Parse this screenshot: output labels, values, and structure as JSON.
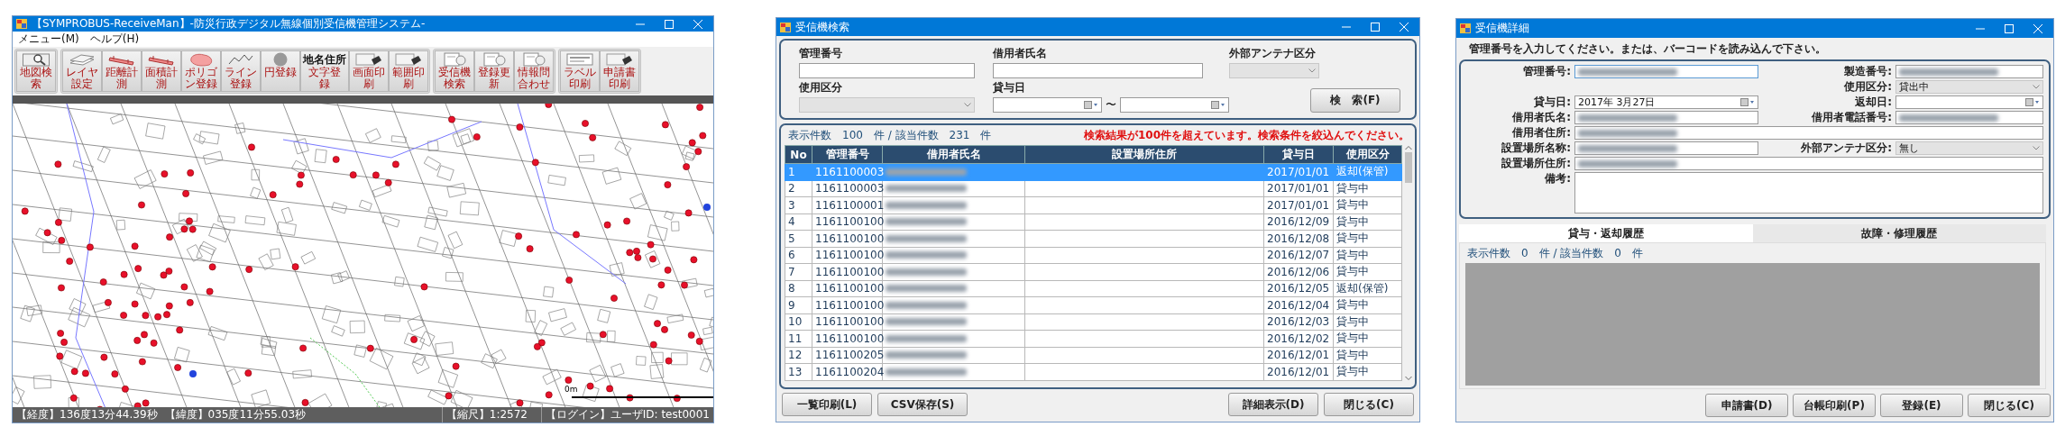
{
  "map_window": {
    "title": "【SYMPROBUS-ReceiveMan】-防災行政デジタル無線個別受信機管理システム-",
    "menu": [
      "メニュー(M)",
      "ヘルプ(H)"
    ],
    "toolbar": [
      [
        {
          "label": "地図検索",
          "kind": "magnifier"
        }
      ],
      [
        {
          "label": "レイヤ設定",
          "kind": "layer"
        },
        {
          "label": "距離計測",
          "kind": "ruler"
        },
        {
          "label": "面積計測",
          "kind": "ruler"
        },
        {
          "label": "ポリゴン登録",
          "kind": "polygon"
        },
        {
          "label": "ライン登録",
          "kind": "line"
        },
        {
          "label": "円登録",
          "kind": "circle"
        },
        {
          "label": "文字登録",
          "kind": "text",
          "icon_text": "地名住所"
        },
        {
          "label": "画面印刷",
          "kind": "printer"
        },
        {
          "label": "範囲印刷",
          "kind": "printer"
        }
      ],
      [
        {
          "label": "受信機検索",
          "kind": "document"
        },
        {
          "label": "登録更新",
          "kind": "document"
        },
        {
          "label": "情報問合わせ",
          "kind": "document"
        }
      ],
      [
        {
          "label": "ラベル印刷",
          "kind": "label"
        },
        {
          "label": "申請書印刷",
          "kind": "printer"
        }
      ]
    ],
    "map": {
      "scale_label": "0m"
    },
    "status_bar": {
      "longitude": "【経度】136度13分44.39秒",
      "latitude": "【緯度】035度11分55.03秒",
      "scale": "【縮尺】1:2572",
      "login": "【ログイン】ユーザID: test0001"
    }
  },
  "search_window": {
    "title": "受信機検索",
    "filter_rows": [
      [
        {
          "label": "管理番号",
          "kind": "text"
        },
        {
          "label": "借用者氏名",
          "kind": "text"
        },
        {
          "label": "外部アンテナ区分",
          "kind": "select",
          "disabled": true
        }
      ],
      [
        {
          "label": "使用区分",
          "kind": "select",
          "disabled": true
        },
        {
          "label": "貸与日",
          "kind": "daterange",
          "separator": "〜"
        }
      ]
    ],
    "search_button": "検　索(F)",
    "count_text": "表示件数　100　件 / 該当件数　231　件",
    "warning": "検索結果が100件を超えています。検索条件を絞込んでください。",
    "table": {
      "columns": [
        "No",
        "管理番号",
        "借用者氏名",
        "設置場所住所",
        "貸与日",
        "使用区分"
      ],
      "rows": [
        {
          "no": "1",
          "id": "1161100003",
          "date": "2017/01/01",
          "status": "返却(保管)",
          "selected": true
        },
        {
          "no": "2",
          "id": "1161100003",
          "date": "2017/01/01",
          "status": "貸与中",
          "selected": false
        },
        {
          "no": "3",
          "id": "1161100001",
          "date": "2017/01/01",
          "status": "貸与中",
          "selected": false
        },
        {
          "no": "4",
          "id": "1161100100",
          "date": "2016/12/09",
          "status": "貸与中",
          "selected": false
        },
        {
          "no": "5",
          "id": "1161100100",
          "date": "2016/12/08",
          "status": "貸与中",
          "selected": false
        },
        {
          "no": "6",
          "id": "1161100100",
          "date": "2016/12/07",
          "status": "貸与中",
          "selected": false
        },
        {
          "no": "7",
          "id": "1161100100",
          "date": "2016/12/06",
          "status": "貸与中",
          "selected": false
        },
        {
          "no": "8",
          "id": "1161100100",
          "date": "2016/12/05",
          "status": "返却(保管)",
          "selected": false
        },
        {
          "no": "9",
          "id": "1161100100",
          "date": "2016/12/04",
          "status": "貸与中",
          "selected": false
        },
        {
          "no": "10",
          "id": "1161100100",
          "date": "2016/12/03",
          "status": "貸与中",
          "selected": false
        },
        {
          "no": "11",
          "id": "1161100100",
          "date": "2016/12/02",
          "status": "貸与中",
          "selected": false
        },
        {
          "no": "12",
          "id": "1161100205",
          "date": "2016/12/01",
          "status": "貸与中",
          "selected": false
        },
        {
          "no": "13",
          "id": "1161100204",
          "date": "2016/12/01",
          "status": "貸与中",
          "selected": false
        }
      ]
    },
    "buttons_left": [
      "一覧印刷(L)",
      "CSV保存(S)"
    ],
    "buttons_right": [
      "詳細表示(D)",
      "閉じる(C)"
    ]
  },
  "detail_window": {
    "title": "受信機詳細",
    "instruction": "管理番号を入力してください。または、バーコードを読み込んで下さい。",
    "form_rows": [
      [
        {
          "label": "管理番号:",
          "kind": "text",
          "blurred": true,
          "focused": true
        },
        {
          "label": "製造番号:",
          "kind": "text",
          "blurred": true
        }
      ],
      [
        {
          "kind": "empty"
        },
        {
          "label": "使用区分:",
          "kind": "select",
          "value": "貸出中",
          "disabled": true
        }
      ],
      [
        {
          "label": "貸与日:",
          "kind": "date",
          "value": "2017年 3月27日"
        },
        {
          "label": "返却日:",
          "kind": "date"
        }
      ],
      [
        {
          "label": "借用者氏名:",
          "kind": "text",
          "blurred": true
        },
        {
          "label": "借用者電話番号:",
          "kind": "text",
          "blurred": true
        }
      ],
      [
        {
          "label": "借用者住所:",
          "kind": "text",
          "blurred": true
        }
      ],
      [
        {
          "label": "設置場所名称:",
          "kind": "text",
          "blurred": true
        },
        {
          "label": "外部アンテナ区分:",
          "kind": "select",
          "value": "無し",
          "disabled": true
        }
      ],
      [
        {
          "label": "設置場所住所:",
          "kind": "text",
          "blurred": true
        }
      ],
      [
        {
          "label": "備考:",
          "kind": "textarea"
        }
      ]
    ],
    "tabs": [
      {
        "label": "貸与・返却履歴",
        "selected": true
      },
      {
        "label": "故障・修理履歴",
        "selected": false
      }
    ],
    "count_text": "表示件数　0　件 / 該当件数　0　件",
    "buttons": [
      "申請書(D)",
      "台帳印刷(P)",
      "登録(E)",
      "閉じる(C)"
    ]
  }
}
